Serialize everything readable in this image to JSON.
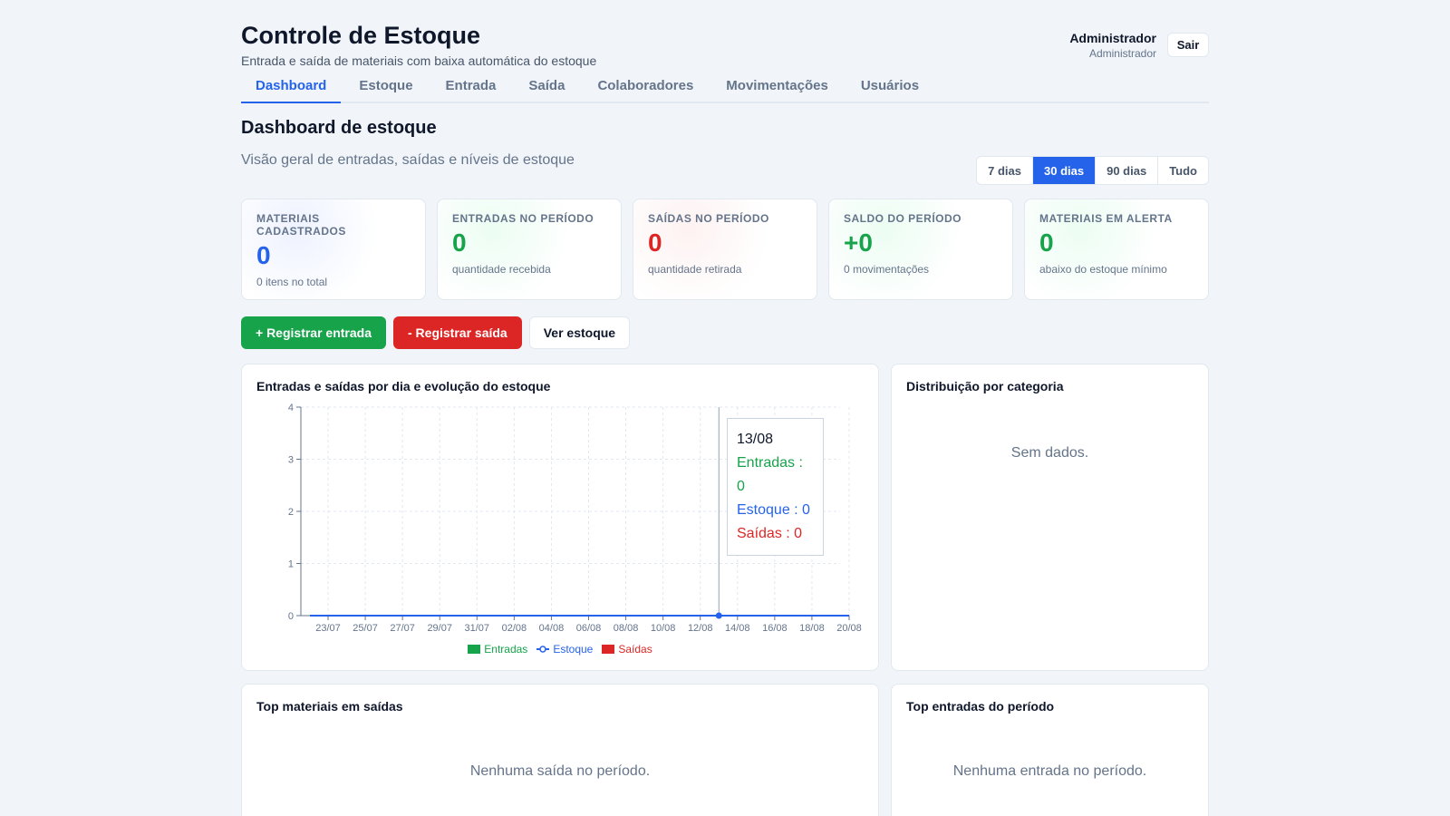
{
  "header": {
    "title": "Controle de Estoque",
    "subtitle": "Entrada e saída de materiais com baixa automática do estoque",
    "user_name": "Administrador",
    "user_role": "Administrador",
    "logout_label": "Sair"
  },
  "tabs": [
    {
      "label": "Dashboard",
      "active": true
    },
    {
      "label": "Estoque"
    },
    {
      "label": "Entrada"
    },
    {
      "label": "Saída"
    },
    {
      "label": "Colaboradores"
    },
    {
      "label": "Movimentações"
    },
    {
      "label": "Usuários"
    }
  ],
  "dashboard": {
    "title": "Dashboard de estoque",
    "subtitle": "Visão geral de entradas, saídas e níveis de estoque"
  },
  "ranges": [
    {
      "label": "7 dias"
    },
    {
      "label": "30 dias",
      "active": true
    },
    {
      "label": "90 dias"
    },
    {
      "label": "Tudo"
    }
  ],
  "stats": [
    {
      "label": "Materiais cadastrados",
      "value": "0",
      "hint": "0 itens no total",
      "color": "#2563eb"
    },
    {
      "label": "Entradas no período",
      "value": "0",
      "hint": "quantidade recebida",
      "color": "#16a34a"
    },
    {
      "label": "Saídas no período",
      "value": "0",
      "hint": "quantidade retirada",
      "color": "#dc2626"
    },
    {
      "label": "Saldo do período",
      "value": "+0",
      "hint": "0 movimentações",
      "color": "#16a34a"
    },
    {
      "label": "Materiais em alerta",
      "value": "0",
      "hint": "abaixo do estoque mínimo",
      "color": "#16a34a"
    }
  ],
  "actions": {
    "add_entry": "+ Registrar entrada",
    "add_exit": "- Registrar saída",
    "view_stock": "Ver estoque"
  },
  "chart_card": {
    "title": "Entradas e saídas por dia e evolução do estoque"
  },
  "tooltip": {
    "date": "13/08",
    "entradas": "Entradas : 0",
    "estoque": "Estoque : 0",
    "saidas": "Saídas : 0"
  },
  "category_card": {
    "title": "Distribuição por categoria",
    "empty": "Sem dados."
  },
  "top_exits_card": {
    "title": "Top materiais em saídas",
    "empty": "Nenhuma saída no período."
  },
  "top_entries_card": {
    "title": "Top entradas do período",
    "empty": "Nenhuma entrada no período."
  },
  "chart_data": {
    "type": "line",
    "title": "Entradas e saídas por dia e evolução do estoque",
    "x_ticks": [
      "23/07",
      "25/07",
      "27/07",
      "29/07",
      "31/07",
      "02/08",
      "04/08",
      "06/08",
      "08/08",
      "10/08",
      "12/08",
      "14/08",
      "16/08",
      "18/08",
      "20/08"
    ],
    "y_ticks": [
      0,
      1,
      2,
      3,
      4
    ],
    "ylim": [
      0,
      4
    ],
    "grid": true,
    "legend_position": "bottom",
    "highlighted_x": "13/08",
    "series": [
      {
        "name": "Entradas",
        "kind": "bar",
        "color": "#16a34a",
        "values": [
          0,
          0,
          0,
          0,
          0,
          0,
          0,
          0,
          0,
          0,
          0,
          0,
          0,
          0,
          0
        ]
      },
      {
        "name": "Estoque",
        "kind": "line",
        "color": "#2563eb",
        "values": [
          0,
          0,
          0,
          0,
          0,
          0,
          0,
          0,
          0,
          0,
          0,
          0,
          0,
          0,
          0
        ]
      },
      {
        "name": "Saídas",
        "kind": "bar",
        "color": "#dc2626",
        "values": [
          0,
          0,
          0,
          0,
          0,
          0,
          0,
          0,
          0,
          0,
          0,
          0,
          0,
          0,
          0
        ]
      }
    ]
  }
}
